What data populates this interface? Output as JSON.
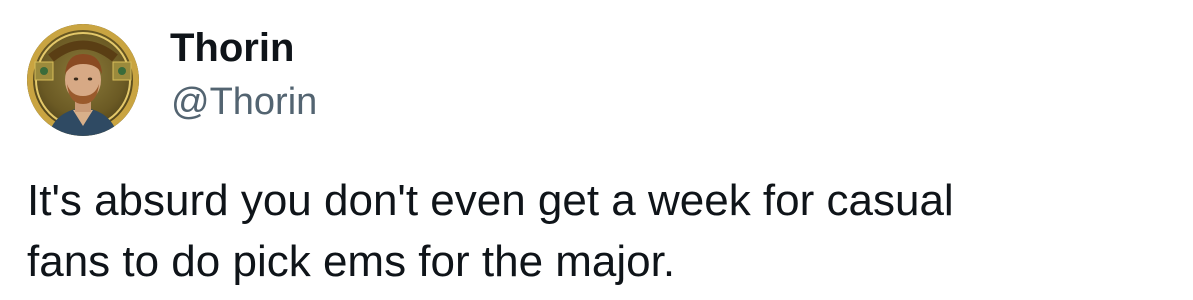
{
  "tweet": {
    "author": {
      "display_name": "Thorin",
      "handle": "@Thorin",
      "avatar_icon": "profile-photo"
    },
    "text_lines": [
      "It's absurd you don't even get a week for casual",
      "fans to do pick ems for the major."
    ]
  },
  "colors": {
    "text_primary": "#0f1419",
    "text_secondary": "#536471",
    "background": "#ffffff",
    "avatar_ring": "#c9a441"
  }
}
